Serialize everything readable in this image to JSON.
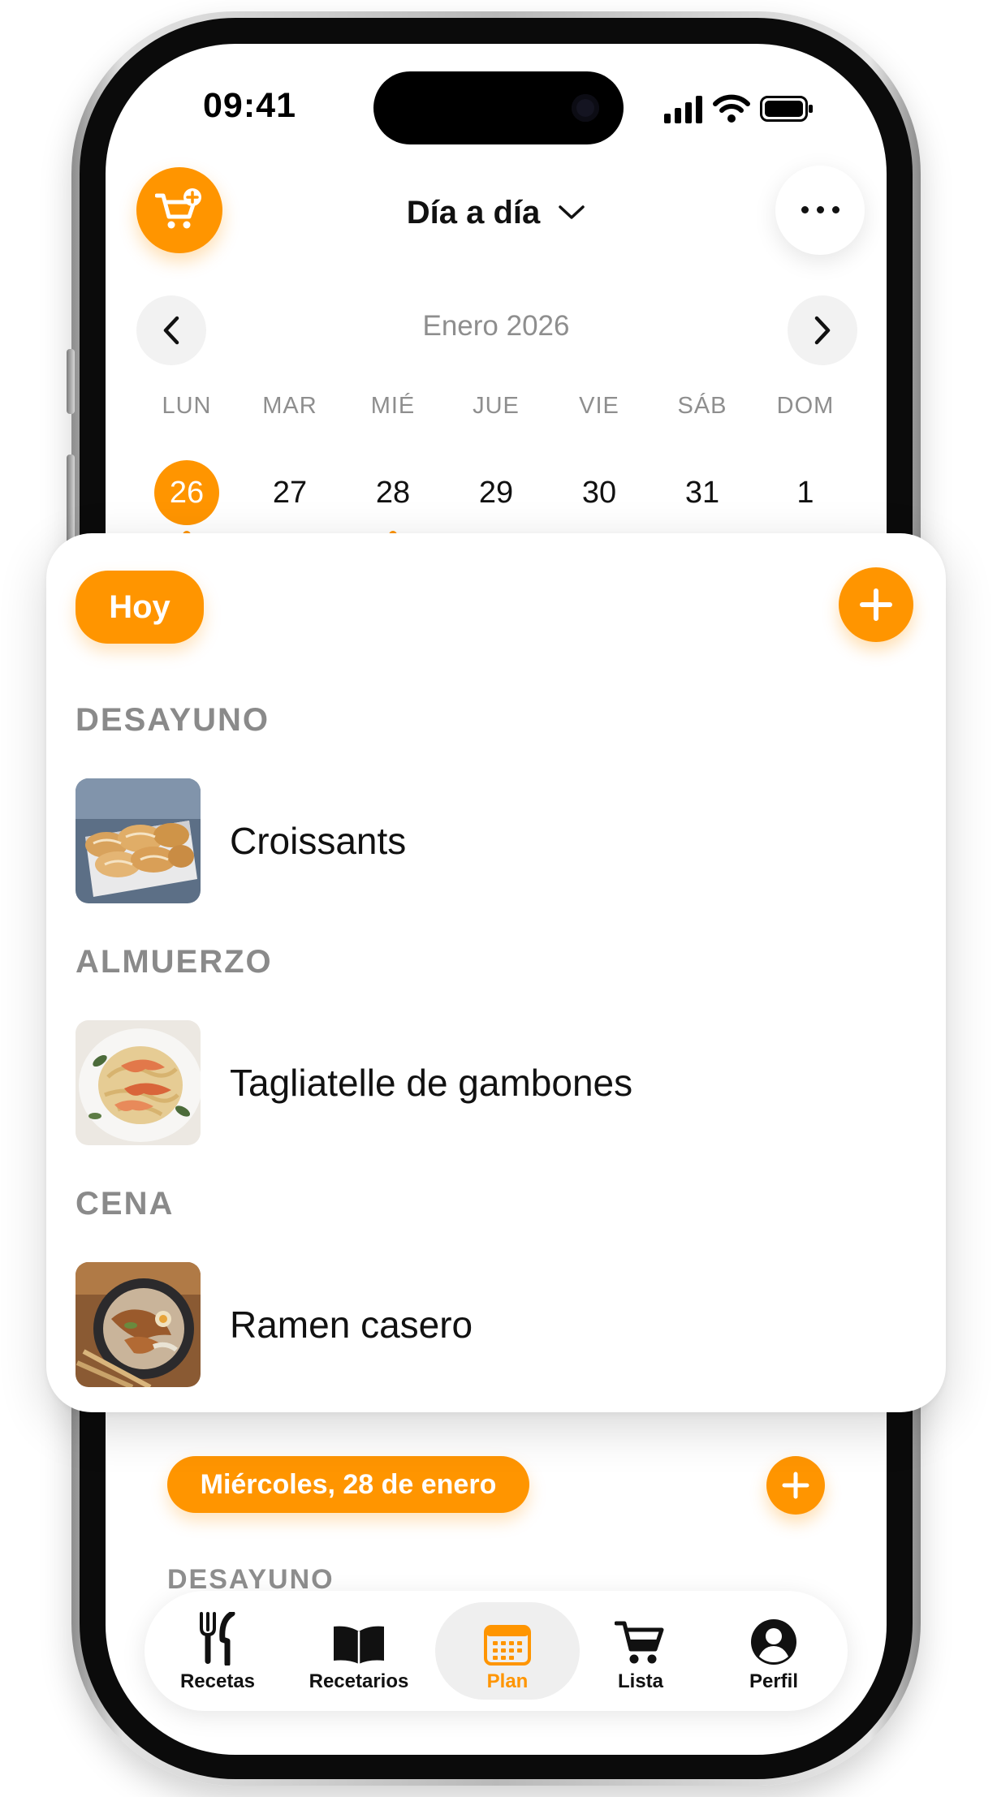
{
  "status_bar": {
    "time": "09:41"
  },
  "header": {
    "title": "Día a día",
    "cart_icon": "cart-plus-icon",
    "more_icon": "ellipsis-icon"
  },
  "calendar": {
    "month": "Enero 2026",
    "days": [
      {
        "weekday": "LUN",
        "day": "26",
        "selected": true,
        "has_plan": true
      },
      {
        "weekday": "MAR",
        "day": "27",
        "selected": false,
        "has_plan": false
      },
      {
        "weekday": "MIÉ",
        "day": "28",
        "selected": false,
        "has_plan": true
      },
      {
        "weekday": "JUE",
        "day": "29",
        "selected": false,
        "has_plan": false
      },
      {
        "weekday": "VIE",
        "day": "30",
        "selected": false,
        "has_plan": false
      },
      {
        "weekday": "SÁB",
        "day": "31",
        "selected": false,
        "has_plan": false
      },
      {
        "weekday": "DOM",
        "day": "1",
        "selected": false,
        "has_plan": false
      }
    ]
  },
  "today_card": {
    "label": "Hoy",
    "meals": [
      {
        "section": "DESAYUNO",
        "name": "Croissants"
      },
      {
        "section": "ALMUERZO",
        "name": "Tagliatelle de gambones"
      },
      {
        "section": "CENA",
        "name": "Ramen casero"
      }
    ]
  },
  "next_day": {
    "label": "Miércoles, 28 de enero",
    "first_section": "DESAYUNO"
  },
  "tabbar": {
    "tabs": [
      {
        "label": "Recetas",
        "icon": "fork-knife-icon",
        "active": false
      },
      {
        "label": "Recetarios",
        "icon": "book-icon",
        "active": false
      },
      {
        "label": "Plan",
        "icon": "calendar-icon",
        "active": true
      },
      {
        "label": "Lista",
        "icon": "cart-icon",
        "active": false
      },
      {
        "label": "Perfil",
        "icon": "person-circle-icon",
        "active": false
      }
    ]
  },
  "colors": {
    "accent": "#ff9500",
    "muted": "#8e8e8e",
    "text": "#111111"
  }
}
